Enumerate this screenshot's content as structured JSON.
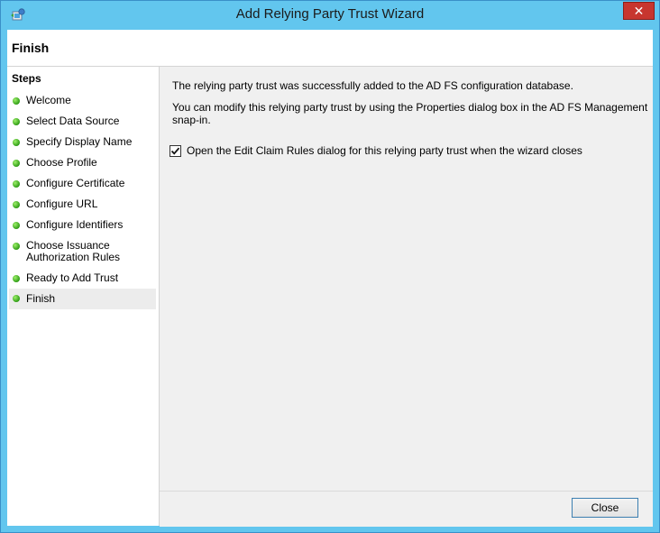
{
  "window": {
    "title": "Add Relying Party Trust Wizard",
    "close_glyph": "✕"
  },
  "header": {
    "title": "Finish"
  },
  "sidebar": {
    "heading": "Steps",
    "items": [
      {
        "label": "Welcome"
      },
      {
        "label": "Select Data Source"
      },
      {
        "label": "Specify Display Name"
      },
      {
        "label": "Choose Profile"
      },
      {
        "label": "Configure Certificate"
      },
      {
        "label": "Configure URL"
      },
      {
        "label": "Configure Identifiers"
      },
      {
        "label": "Choose Issuance Authorization Rules"
      },
      {
        "label": "Ready to Add Trust"
      },
      {
        "label": "Finish"
      }
    ],
    "active_index": 9,
    "status_color": "#36a81c"
  },
  "main": {
    "message1": "The relying party trust was successfully added to the AD FS configuration database.",
    "message2": "You can modify this relying party trust by using the Properties dialog box in the AD FS Management snap-in.",
    "checkbox": {
      "label": "Open the Edit Claim Rules dialog for this relying party trust when the wizard closes",
      "checked": true
    }
  },
  "footer": {
    "close_label": "Close"
  },
  "colors": {
    "titlebar": "#62c6ee",
    "close_button": "#c7362f"
  }
}
